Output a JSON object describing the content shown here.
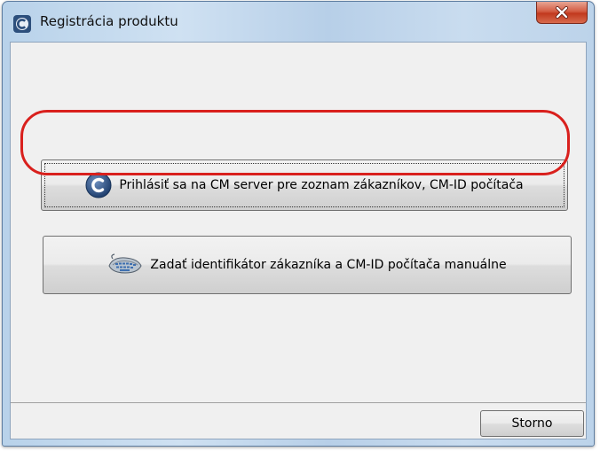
{
  "window": {
    "title": "Registrácia produktu",
    "icon": "product-c-icon",
    "close_icon": "close-icon"
  },
  "buttons": {
    "login_label": "Prihlásiť sa na CM server pre zoznam zákazníkov, CM-ID počítača",
    "login_icon": "c-logo-icon",
    "manual_label": "Zadať identifikátor zákazníka a CM-ID počítača manuálne",
    "manual_icon": "keyboard-icon",
    "cancel_label": "Storno"
  },
  "colors": {
    "highlight": "#d9201d",
    "close_button": "#c1391e",
    "dialog_background": "#f0f0f0"
  }
}
